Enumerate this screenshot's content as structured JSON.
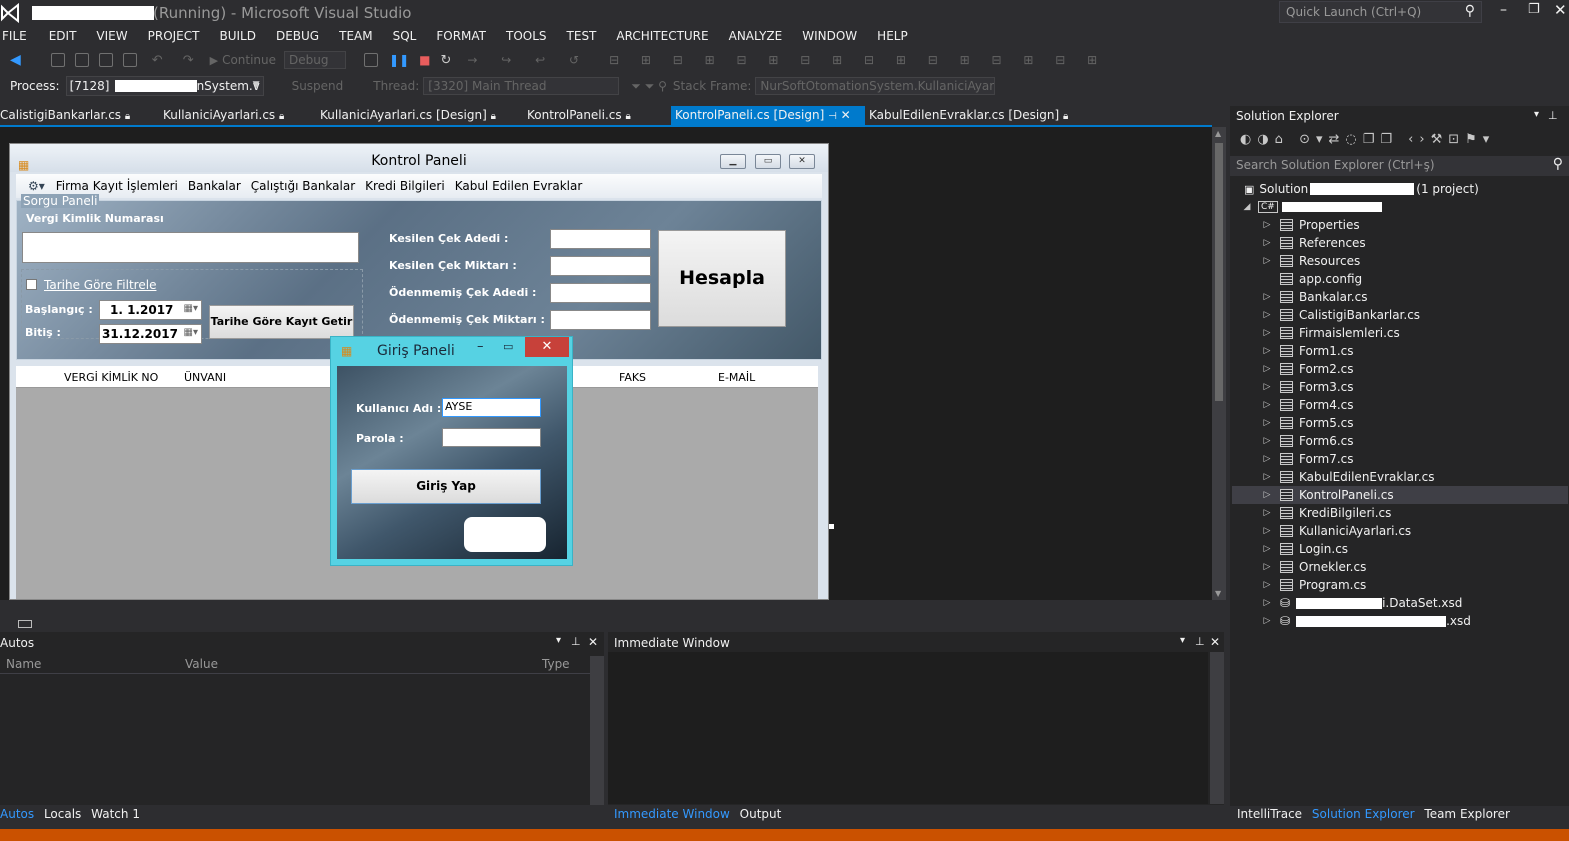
{
  "window": {
    "title_suffix": "(Running) - Microsoft Visual Studio",
    "quick_launch": "Quick Launch (Ctrl+Q)"
  },
  "menu": [
    "FILE",
    "EDIT",
    "VIEW",
    "PROJECT",
    "BUILD",
    "DEBUG",
    "TEAM",
    "SQL",
    "FORMAT",
    "TOOLS",
    "TEST",
    "ARCHITECTURE",
    "ANALYZE",
    "WINDOW",
    "HELP"
  ],
  "toolbar": {
    "continue": "Continue",
    "config": "Debug"
  },
  "debugbar": {
    "process_label": "Process:",
    "process_value": "[7128]",
    "process_tail": "nSystem.v",
    "suspend": "Suspend",
    "thread_label": "Thread:",
    "thread_value": "[3320] Main Thread",
    "stack_label": "Stack Frame:",
    "stack_value": "NurSoftOtomationSystem.KullaniciAyarlar"
  },
  "tabs": [
    "CalistigiBankarlar.cs",
    "KullaniciAyarlari.cs",
    "KullaniciAyarlari.cs [Design]",
    "KontrolPaneli.cs",
    "KontrolPaneli.cs [Design]",
    "KabulEdilenEvraklar.cs [Design]"
  ],
  "form": {
    "title": "Kontrol Paneli",
    "menu": [
      "Firma Kayıt İşlemleri",
      "Bankalar",
      "Çalıştığı Bankalar",
      "Kredi Bilgileri",
      "Kabul Edilen Evraklar"
    ],
    "group_title": "Sorgu Paneli",
    "vkn_label": "Vergi Kimlik Numarası",
    "date_filter": "Tarihe Göre Filtrele",
    "start_label": "Başlangıç :",
    "start_value": "1.  1.2017",
    "end_label": "Bitiş :",
    "end_value": "31.12.2017",
    "fetch_button": "Tarihe Göre Kayıt Getir",
    "labels": [
      "Kesilen Çek Adedi :",
      "Kesilen Çek Miktarı :",
      "Ödenmemiş Çek Adedi :",
      "Ödenmemiş Çek Miktarı :"
    ],
    "calc_button": "Hesapla",
    "grid_headers": [
      "VERGİ KİMLİK NO",
      "ÜNVANI",
      "FAKS",
      "E-MAİL"
    ]
  },
  "login": {
    "title": "Giriş Paneli",
    "user_label": "Kullanıcı Adı :",
    "user_value": "AYSE",
    "pass_label": "Parola :",
    "button": "Giriş Yap"
  },
  "autos": {
    "title": "Autos",
    "cols": [
      "Name",
      "Value",
      "Type"
    ]
  },
  "immediate": {
    "title": "Immediate Window"
  },
  "bottom_tabs_left": [
    "Autos",
    "Locals",
    "Watch 1"
  ],
  "bottom_tabs_mid": [
    "Immediate Window",
    "Output"
  ],
  "bottom_tabs_right": [
    "IntelliTrace",
    "Solution Explorer",
    "Team Explorer"
  ],
  "solution": {
    "title": "Solution Explorer",
    "search": "Search Solution Explorer (Ctrl+ş)",
    "root_prefix": "Solution",
    "root_suffix": "(1 project)",
    "items": [
      "Properties",
      "References",
      "Resources",
      "app.config",
      "Bankalar.cs",
      "CalistigiBankarlar.cs",
      "Firmaislemleri.cs",
      "Form1.cs",
      "Form2.cs",
      "Form3.cs",
      "Form4.cs",
      "Form5.cs",
      "Form6.cs",
      "Form7.cs",
      "KabulEdilenEvraklar.cs",
      "KontrolPaneli.cs",
      "KrediBilgileri.cs",
      "KullaniciAyarlari.cs",
      "Login.cs",
      "Ornekler.cs",
      "Program.cs"
    ],
    "xsd1": "i.DataSet.xsd",
    "xsd2": ".xsd"
  }
}
